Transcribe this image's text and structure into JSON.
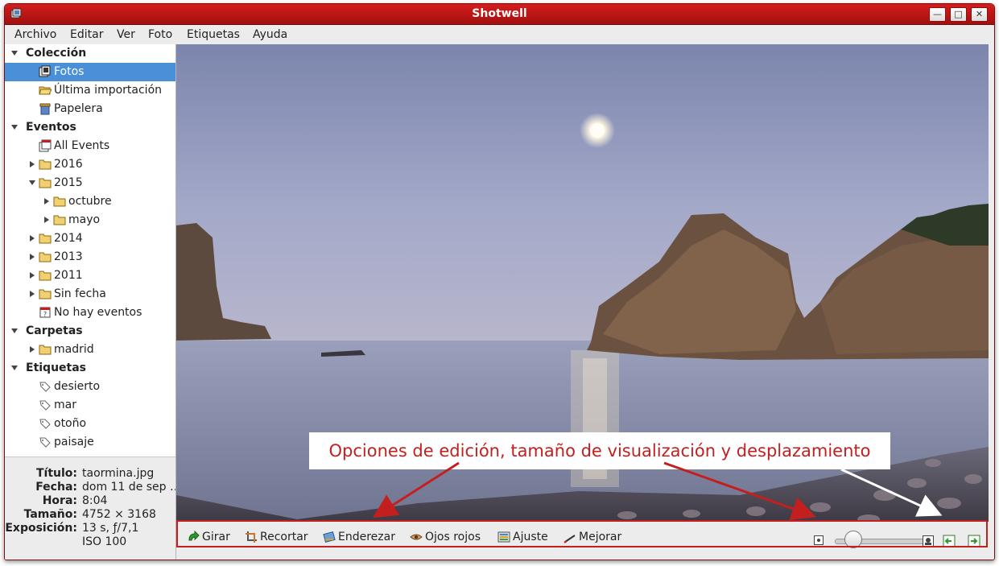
{
  "window": {
    "title": "Shotwell"
  },
  "menu": [
    "Archivo",
    "Editar",
    "Ver",
    "Foto",
    "Etiquetas",
    "Ayuda"
  ],
  "sidebar": {
    "sections": {
      "coleccion": "Colección",
      "eventos": "Eventos",
      "carpetas": "Carpetas",
      "etiquetas": "Etiquetas"
    },
    "coleccion_items": [
      "Fotos",
      "Última importación",
      "Papelera"
    ],
    "eventos_items": {
      "all": "All Events",
      "y2016": "2016",
      "y2015": "2015",
      "octubre": "octubre",
      "mayo": "mayo",
      "y2014": "2014",
      "y2013": "2013",
      "y2011": "2011",
      "sin_fecha": "Sin fecha",
      "no_eventos": "No hay eventos"
    },
    "carpetas_items": [
      "madrid"
    ],
    "etiquetas_items": [
      "desierto",
      "mar",
      "otoño",
      "paisaje"
    ],
    "selected": "Fotos"
  },
  "metadata": {
    "titulo_label": "Título:",
    "titulo": "taormina.jpg",
    "fecha_label": "Fecha:",
    "fecha": "dom 11 de sep …",
    "hora_label": "Hora:",
    "hora": "8:04",
    "tamano_label": "Tamaño:",
    "tamano": "4752 × 3168",
    "exposicion_label": "Exposición:",
    "exposicion": "13 s, ƒ/7,1",
    "iso": "ISO 100"
  },
  "toolbar": {
    "girar": "Girar",
    "recortar": "Recortar",
    "enderezar": "Enderezar",
    "ojos_rojos": "Ojos rojos",
    "ajuste": "Ajuste",
    "mejorar": "Mejorar",
    "zoom_level": 0.2
  },
  "annotation": {
    "text": "Opciones de edición, tamaño de visualización y desplazamiento",
    "color": "#c41f1f"
  },
  "colors": {
    "accent": "#4a90d9",
    "titlebar": "#c41717"
  }
}
